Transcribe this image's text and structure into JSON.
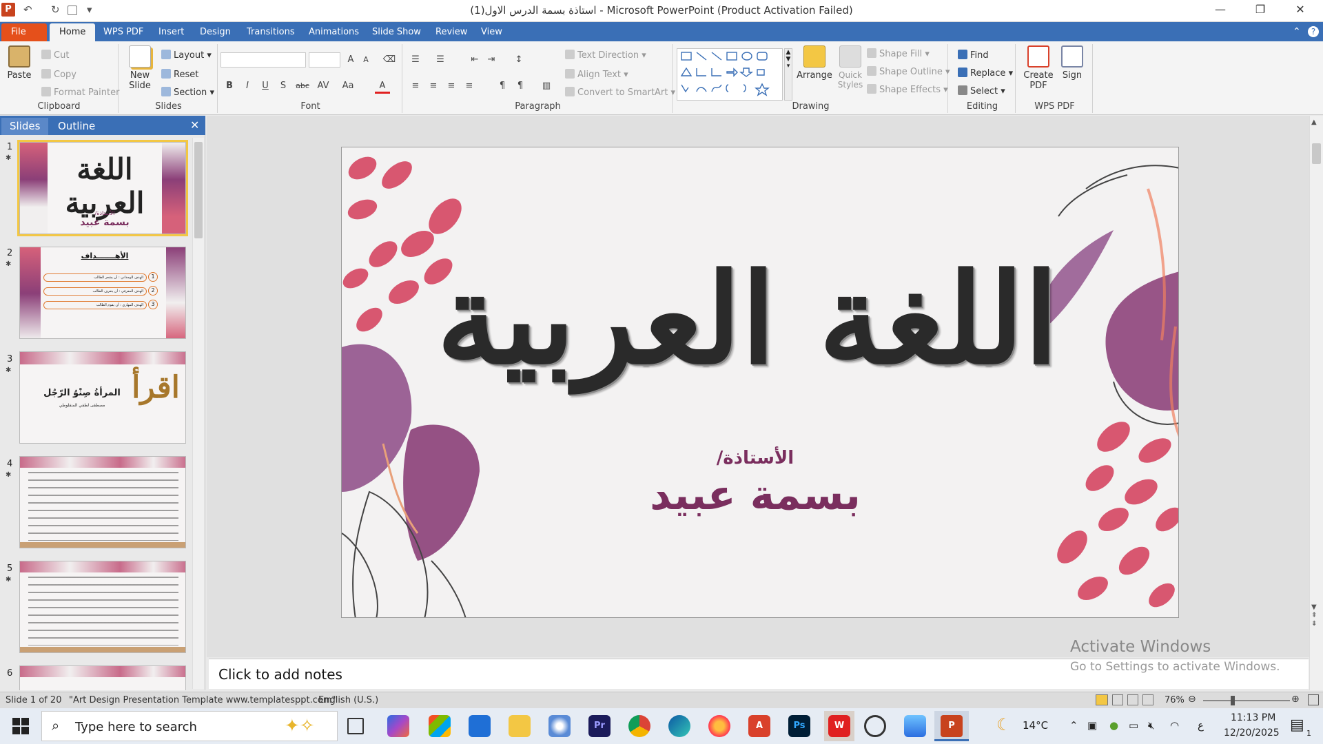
{
  "window": {
    "title": "(1)استاذة بسمة الدرس الاول - Microsoft PowerPoint (Product Activation Failed)",
    "app_logo": "P",
    "minimize": "—",
    "restore": "❐",
    "close": "✕"
  },
  "qat": {
    "undo": "↶",
    "redo": "↻",
    "customize": "▾"
  },
  "tabs": [
    "File",
    "Home",
    "WPS PDF",
    "Insert",
    "Design",
    "Transitions",
    "Animations",
    "Slide Show",
    "Review",
    "View"
  ],
  "ribbon": {
    "clipboard": {
      "label": "Clipboard",
      "paste": "Paste",
      "cut": "Cut",
      "copy": "Copy",
      "format_painter": "Format Painter"
    },
    "slides": {
      "label": "Slides",
      "new_slide": "New Slide",
      "layout": "Layout",
      "reset": "Reset",
      "section": "Section"
    },
    "font": {
      "label": "Font",
      "bold": "B",
      "italic": "I",
      "underline": "U",
      "strike": "abc",
      "shadow": "S",
      "case": "Aa",
      "color": "A"
    },
    "paragraph": {
      "label": "Paragraph",
      "text_direction": "Text Direction",
      "align_text": "Align Text",
      "convert_smartart": "Convert to SmartArt"
    },
    "drawing": {
      "label": "Drawing",
      "arrange": "Arrange",
      "quick_styles": "Quick Styles",
      "shape_fill": "Shape Fill",
      "shape_outline": "Shape Outline",
      "shape_effects": "Shape Effects"
    },
    "editing": {
      "label": "Editing",
      "find": "Find",
      "replace": "Replace",
      "select": "Select"
    },
    "wps_pdf": {
      "label": "WPS PDF",
      "create_pdf": "Create PDF",
      "sign": "Sign"
    }
  },
  "slide_pane": {
    "tabs": [
      "Slides",
      "Outline"
    ],
    "close": "✕",
    "thumbs": [
      {
        "num": "1",
        "title": "اللغة العربية",
        "sub1": "الأستاذة/",
        "sub2": "بسمة عبيد"
      },
      {
        "num": "2",
        "title": "الأهـــــــداف",
        "items": [
          "الهدف الوجداني : أن يشعر الطالب",
          "الهدف المعرفي : أن يتعرف الطالب",
          "الهدف المهاري : أن يقوم الطالب"
        ],
        "nums": [
          "1",
          "2",
          "3"
        ]
      },
      {
        "num": "3",
        "title": "المرأةُ صِنْوُ الرّجُل",
        "sub": "مصطفى لطفي المنفلوطي",
        "word": "اقرأ"
      },
      {
        "num": "4"
      },
      {
        "num": "5"
      },
      {
        "num": "6"
      }
    ]
  },
  "slide": {
    "title_calligraphy": "اللغة العربية",
    "teacher_label": "الأستاذة/",
    "teacher_name": "بسمة عبيد"
  },
  "notes": {
    "placeholder": "Click to add notes"
  },
  "watermark": {
    "activate_title": "Activate Windows",
    "activate_sub": "Go to Settings to activate Windows."
  },
  "status": {
    "slide_info": "Slide 1 of 20",
    "theme": "\"Art Design Presentation Template www.templatesppt.com\"",
    "language": "English (U.S.)",
    "zoom": "76%"
  },
  "taskbar": {
    "search_placeholder": "Type here to search",
    "weather": "14°C",
    "lang": "ع",
    "time": "11:13 PM",
    "date": "12/20/2025",
    "notif_count": "1"
  }
}
